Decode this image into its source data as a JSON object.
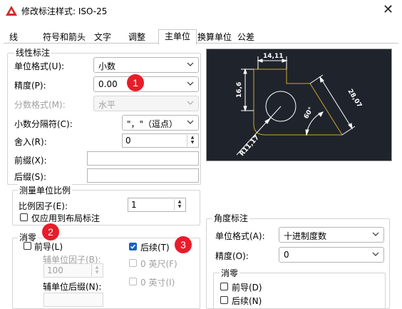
{
  "window": {
    "title": "修改标注样式: ISO-25",
    "close_glyph": "✕"
  },
  "tabs": [
    {
      "label": "线"
    },
    {
      "label": "符号和箭头"
    },
    {
      "label": "文字"
    },
    {
      "label": "调整"
    },
    {
      "label": "主单位"
    },
    {
      "label": "换算单位"
    },
    {
      "label": "公差"
    }
  ],
  "linear": {
    "group_label": "线性标注",
    "unit_format": {
      "label": "单位格式(U):",
      "value": "小数"
    },
    "precision": {
      "label": "精度(P):",
      "value": "0.00"
    },
    "fraction_format": {
      "label": "分数格式(M):",
      "value": "水平"
    },
    "decimal_separator": {
      "label": "小数分隔符(C):",
      "value": "\"，\"（逗点）"
    },
    "round_off": {
      "label": "舍入(R):",
      "value": "0"
    },
    "prefix": {
      "label": "前缀(X):",
      "value": ""
    },
    "suffix": {
      "label": "后缀(S):",
      "value": ""
    }
  },
  "measurement_scale": {
    "group_label": "测量单位比例",
    "scale_factor": {
      "label": "比例因子(E):",
      "value": "1"
    },
    "apply_layout": {
      "label": "仅应用到布局标注",
      "checked": false
    }
  },
  "zero_suppression": {
    "group_label": "消零",
    "leading": {
      "label": "前导(L)",
      "checked": false
    },
    "trailing": {
      "label": "后续(T)",
      "checked": true
    },
    "sub_unit_factor": {
      "label": "辅单位因子(B):",
      "value": "100"
    },
    "sub_unit_suffix": {
      "label": "辅单位后缀(N):",
      "value": ""
    },
    "feet": {
      "label": "0 英尺(F)"
    },
    "inches": {
      "label": "0 英寸(I)"
    }
  },
  "preview": {
    "dim_top": "14,11",
    "dim_left": "16,6",
    "dim_right": "28,07",
    "dim_angle": "60°",
    "dim_radius": "R11,17"
  },
  "angular": {
    "group_label": "角度标注",
    "unit_format": {
      "label": "单位格式(A):",
      "value": "十进制度数"
    },
    "precision": {
      "label": "精度(O):",
      "value": "0"
    },
    "zero_group_label": "消零",
    "leading": {
      "label": "前导(D)",
      "checked": false
    },
    "trailing": {
      "label": "后续(N)",
      "checked": false
    }
  },
  "annotations": {
    "badge1": "1",
    "badge2": "2",
    "badge3": "3"
  },
  "colors": {
    "accent": "#1f5fbf",
    "badge": "#e81c2a",
    "preview_bg": "#1f232b",
    "preview_line": "#c8a830"
  }
}
